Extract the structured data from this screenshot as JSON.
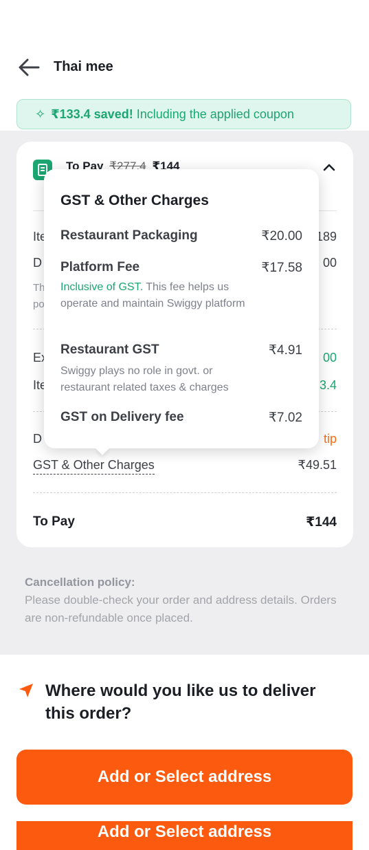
{
  "header": {
    "title": "Thai mee"
  },
  "savings": {
    "text_bold": "₹133.4 saved!",
    "text_rest": "Including the applied coupon",
    "icon": "sparkle-icon"
  },
  "bill": {
    "to_pay_label": "To Pay",
    "to_pay_old": "₹277.4",
    "to_pay_new": "₹144",
    "rows_clipped": [
      {
        "label": "Ite",
        "value": "189"
      },
      {
        "label": "D",
        "value": "00"
      },
      {
        "label": "Th",
        "value": ""
      },
      {
        "label": "po",
        "value": ""
      },
      {
        "label": "Ex",
        "value": "00"
      },
      {
        "label": "Ite",
        "value": "3.4"
      },
      {
        "label": "D",
        "value": "tip"
      }
    ],
    "gst_label": "GST & Other Charges",
    "gst_total": "₹49.51",
    "final_label": "To Pay",
    "final_value": "₹144"
  },
  "popup": {
    "title": "GST & Other Charges",
    "items": [
      {
        "label": "Restaurant Packaging",
        "value": "₹20.00"
      },
      {
        "label": "Platform Fee",
        "value": "₹17.58",
        "desc_green": "Inclusive of GST.",
        "desc": "This fee helps us operate and maintain Swiggy platform"
      },
      {
        "label": "Restaurant GST",
        "value": "₹4.91",
        "desc": "Swiggy plays no role in govt. or restaurant related taxes & charges"
      },
      {
        "label": "GST on Delivery fee",
        "value": "₹7.02"
      }
    ]
  },
  "policy": {
    "title": "Cancellation policy:",
    "text": "Please double-check your order and address details. Orders are non-refundable once placed."
  },
  "delivery": {
    "question": "Where would you like us to deliver this order?",
    "button_label": "Add or Select address",
    "ghost_label": "Add or Select address"
  },
  "colors": {
    "accent": "#fc5a0f",
    "green": "#1ba672"
  }
}
